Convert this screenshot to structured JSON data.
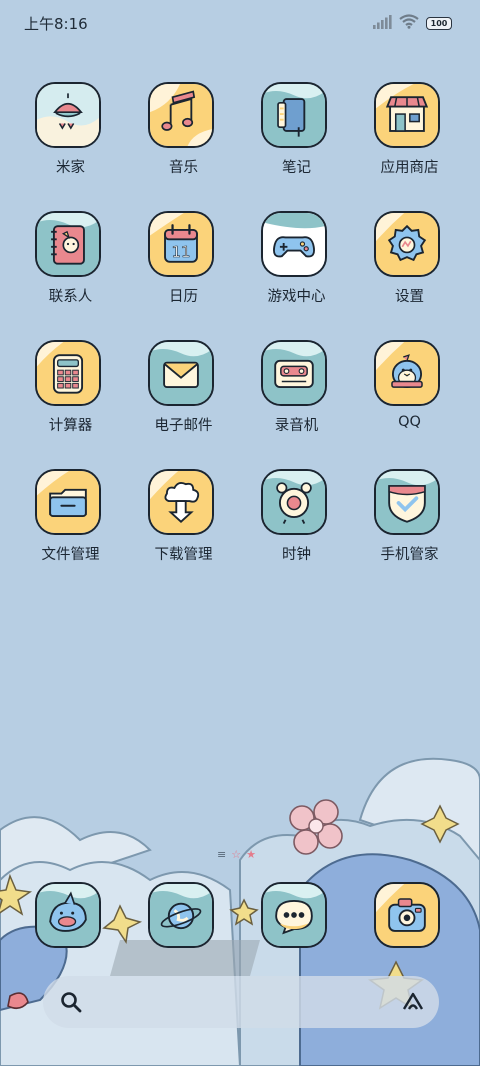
{
  "status": {
    "time": "上午8:16",
    "battery": "100"
  },
  "apps": [
    {
      "label": "米家",
      "icon": "mijia-icon"
    },
    {
      "label": "音乐",
      "icon": "music-icon"
    },
    {
      "label": "笔记",
      "icon": "notes-icon"
    },
    {
      "label": "应用商店",
      "icon": "app-store-icon"
    },
    {
      "label": "联系人",
      "icon": "contacts-icon"
    },
    {
      "label": "日历",
      "icon": "calendar-icon"
    },
    {
      "label": "游戏中心",
      "icon": "game-center-icon"
    },
    {
      "label": "设置",
      "icon": "settings-icon"
    },
    {
      "label": "计算器",
      "icon": "calculator-icon"
    },
    {
      "label": "电子邮件",
      "icon": "email-icon"
    },
    {
      "label": "录音机",
      "icon": "recorder-icon"
    },
    {
      "label": "QQ",
      "icon": "qq-icon"
    },
    {
      "label": "文件管理",
      "icon": "file-manager-icon"
    },
    {
      "label": "下载管理",
      "icon": "download-manager-icon"
    },
    {
      "label": "时钟",
      "icon": "clock-icon"
    },
    {
      "label": "手机管家",
      "icon": "security-icon"
    }
  ],
  "calendar_day": "11",
  "dock": [
    {
      "icon": "shark-icon"
    },
    {
      "icon": "browser-icon"
    },
    {
      "icon": "messages-icon"
    },
    {
      "icon": "camera-icon"
    }
  ],
  "colors": {
    "background": "#b7cee3",
    "teal": "#8ec3c8",
    "yellow": "#fbd37a",
    "cream": "#fff6dd",
    "outline": "#1b2530"
  }
}
